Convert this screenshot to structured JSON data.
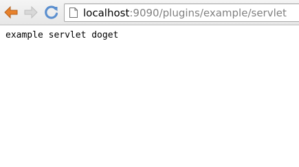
{
  "browser": {
    "url_host": "localhost",
    "url_rest": ":9090/plugins/example/servlet",
    "icons": {
      "back": "back-arrow-icon",
      "forward": "forward-arrow-icon",
      "reload": "reload-icon",
      "page": "page-icon"
    },
    "colors": {
      "back_arrow": "#e8822c",
      "forward_arrow": "#c8c8c8",
      "reload": "#5b8fcf"
    }
  },
  "page": {
    "body_text": "example servlet doget"
  }
}
